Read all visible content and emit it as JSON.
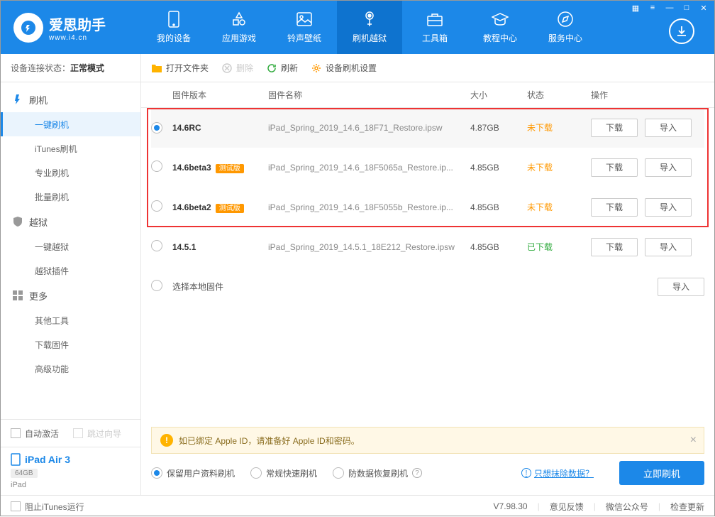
{
  "app": {
    "name": "爱思助手",
    "site": "www.i4.cn"
  },
  "nav": {
    "items": [
      {
        "label": "我的设备"
      },
      {
        "label": "应用游戏"
      },
      {
        "label": "铃声壁纸"
      },
      {
        "label": "刷机越狱"
      },
      {
        "label": "工具箱"
      },
      {
        "label": "教程中心"
      },
      {
        "label": "服务中心"
      }
    ]
  },
  "conn": {
    "label": "设备连接状态：",
    "value": "正常模式"
  },
  "sidebar": {
    "groups": [
      {
        "label": "刷机",
        "items": [
          "一键刷机",
          "iTunes刷机",
          "专业刷机",
          "批量刷机"
        ]
      },
      {
        "label": "越狱",
        "items": [
          "一键越狱",
          "越狱插件"
        ]
      },
      {
        "label": "更多",
        "items": [
          "其他工具",
          "下载固件",
          "高级功能"
        ]
      }
    ],
    "auto_activate": "自动激活",
    "skip_guide": "跳过向导",
    "device": {
      "name": "iPad Air 3",
      "storage": "64GB",
      "type": "iPad"
    }
  },
  "toolbar": {
    "open": "打开文件夹",
    "delete": "删除",
    "refresh": "刷新",
    "settings": "设备刷机设置"
  },
  "columns": {
    "ver": "固件版本",
    "name": "固件名称",
    "size": "大小",
    "state": "状态",
    "ops": "操作"
  },
  "rows": [
    {
      "ver": "14.6RC",
      "badge": "",
      "name": "iPad_Spring_2019_14.6_18F71_Restore.ipsw",
      "size": "4.87GB",
      "state": "未下载",
      "state_cls": "st-orange",
      "dl": "下载",
      "imp": "导入",
      "sel": true
    },
    {
      "ver": "14.6beta3",
      "badge": "测试版",
      "name": "iPad_Spring_2019_14.6_18F5065a_Restore.ip...",
      "size": "4.85GB",
      "state": "未下载",
      "state_cls": "st-orange",
      "dl": "下载",
      "imp": "导入",
      "sel": false
    },
    {
      "ver": "14.6beta2",
      "badge": "测试版",
      "name": "iPad_Spring_2019_14.6_18F5055b_Restore.ip...",
      "size": "4.85GB",
      "state": "未下载",
      "state_cls": "st-orange",
      "dl": "下载",
      "imp": "导入",
      "sel": false
    },
    {
      "ver": "14.5.1",
      "badge": "",
      "name": "iPad_Spring_2019_14.5.1_18E212_Restore.ipsw",
      "size": "4.85GB",
      "state": "已下载",
      "state_cls": "st-green",
      "dl": "下载",
      "imp": "导入",
      "sel": false
    }
  ],
  "local_row": {
    "label": "选择本地固件",
    "imp": "导入"
  },
  "notice": "如已绑定 Apple ID，请准备好 Apple ID和密码。",
  "modes": {
    "keep": "保留用户资料刷机",
    "fast": "常规快速刷机",
    "anti": "防数据恢复刷机",
    "erase_link": "只想抹除数据？",
    "start": "立即刷机"
  },
  "footer": {
    "block_itunes": "阻止iTunes运行",
    "version": "V7.98.30",
    "feedback": "意见反馈",
    "wechat": "微信公众号",
    "update": "检查更新"
  }
}
